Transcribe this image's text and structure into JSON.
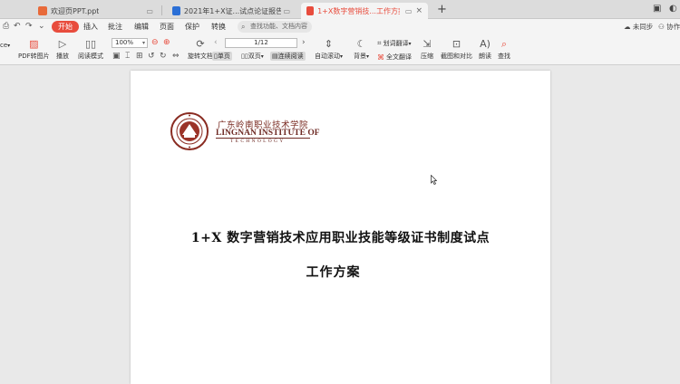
{
  "tabs": [
    {
      "label": "欢迎页PPT.ppt",
      "icon": "ppt-icon",
      "color": "#e86a3a",
      "active": false
    },
    {
      "label": "2021年1+X证...试点论证报告(1)",
      "icon": "word-icon",
      "color": "#2b6fd6",
      "active": false
    },
    {
      "label": "1+X数字营销技...工作方案.pdf",
      "icon": "pdf-icon",
      "color": "#e84c3d",
      "active": true
    }
  ],
  "menu": {
    "start": "开始",
    "insert": "插入",
    "annotate": "批注",
    "edit": "编辑",
    "page": "页面",
    "protect": "保护",
    "convert": "转换",
    "search_placeholder": "查找功能、文档内容",
    "sync": "未同步",
    "collab": "协作"
  },
  "ribbon": {
    "office": "ce",
    "pdf_to_image": "PDF转图片",
    "play": "播放",
    "read_mode": "阅读模式",
    "zoom": "100%",
    "page_indicator": "1/12",
    "rotate": "旋转文档",
    "single_page": "单页",
    "double_page": "双页",
    "continuous": "连续阅读",
    "auto_scroll": "自动滚动",
    "background": "背景",
    "word_translate": "划词翻译",
    "full_translate": "全文翻译",
    "compress": "压缩",
    "screenshot_compare": "截图和对比",
    "read_aloud": "朗读",
    "find": "查找"
  },
  "document": {
    "school_cn": "广东岭南职业技术学院",
    "school_en": "LINGNAN INSTITUTE OF",
    "school_en2": "TECHNOLOGY",
    "title": "1+X 数字营销技术应用职业技能等级证书制度试点",
    "subtitle": "工作方案"
  },
  "colors": {
    "accent": "#e84c3d",
    "logo": "#7a2b22"
  }
}
